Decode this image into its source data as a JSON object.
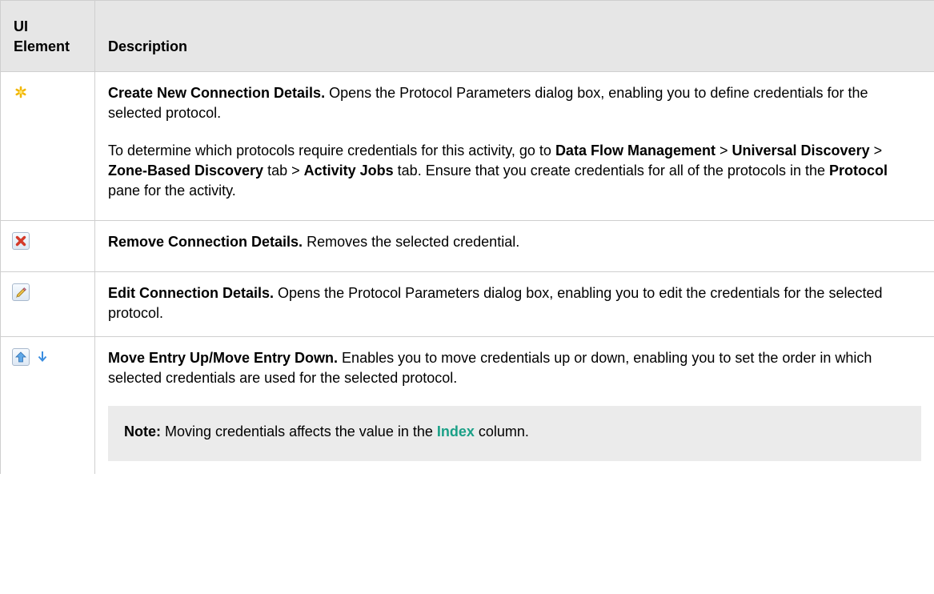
{
  "header": {
    "col_element": "UI Element",
    "col_description": "Description"
  },
  "rows": [
    {
      "icon": "asterisk-new-icon",
      "title": "Create New Connection Details.",
      "text": " Opens the Protocol Parameters dialog box, enabling you to define credentials for the selected protocol.",
      "para2": {
        "t1": "To determine which protocols require credentials for this activity, go to ",
        "b1": "Data Flow Management",
        "t2": " > ",
        "b2": "Universal Discovery",
        "t3": " > ",
        "b3": "Zone-Based Discovery",
        "t4": " tab > ",
        "b4": "Activity Jobs",
        "t5": " tab. Ensure that you create credentials for all of the protocols in the ",
        "b5": "Protocol",
        "t6": " pane for the activity."
      }
    },
    {
      "icon": "remove-x-icon",
      "title": "Remove Connection Details.",
      "text": " Removes the selected credential."
    },
    {
      "icon": "pencil-edit-icon",
      "title": "Edit Connection Details.",
      "text": " Opens the Protocol Parameters dialog box, enabling you to edit the credentials for the selected protocol."
    },
    {
      "icons": [
        "arrow-up-icon",
        "arrow-down-icon"
      ],
      "title": "Move Entry Up/Move Entry Down.",
      "text": " Enables you to move credentials up or down, enabling you to set the order in which selected credentials are used for the selected protocol.",
      "note": {
        "label": "Note:",
        "t1": " Moving credentials affects the value in the ",
        "link": "Index",
        "t2": " column."
      }
    }
  ],
  "colors": {
    "header_bg": "#e6e6e6",
    "border": "#cfcfcf",
    "note_bg": "#ebebeb",
    "link": "#1ba087"
  }
}
